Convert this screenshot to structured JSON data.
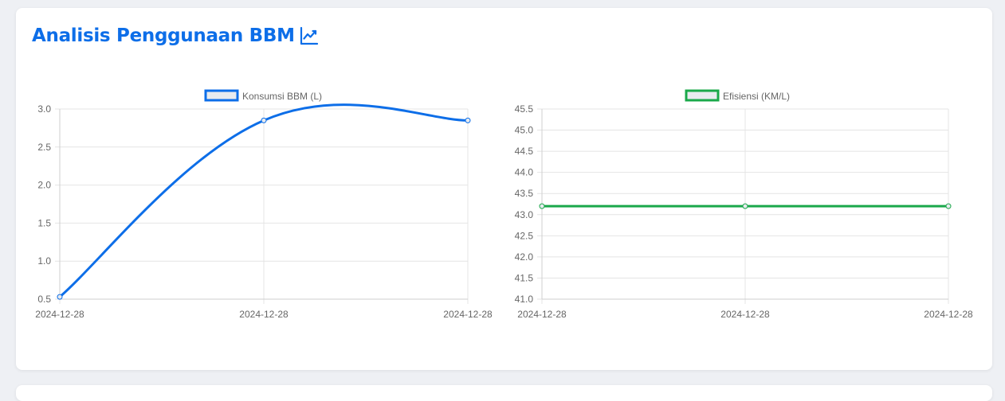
{
  "page": {
    "title": "Analisis Penggunaan BBM",
    "title_icon": "chart-line-icon",
    "accent_color": "#0d6ee8"
  },
  "chart_data": [
    {
      "type": "line",
      "series": [
        {
          "name": "Konsumsi BBM (L)",
          "color": "#0d6ee8",
          "fill": "#e8ebef",
          "x": [
            "2024-12-28",
            "2024-12-28",
            "2024-12-28"
          ],
          "values": [
            0.53,
            2.85,
            2.85
          ]
        }
      ],
      "x_tick_labels": [
        "2024-12-28",
        "2024-12-28",
        "2024-12-28"
      ],
      "y_ticks": [
        "3.0",
        "2.5",
        "2.0",
        "1.5",
        "1.0",
        "0.5"
      ],
      "ylim": [
        0.5,
        3.0
      ],
      "grid": true,
      "legend": "top"
    },
    {
      "type": "line",
      "series": [
        {
          "name": "Efisiensi (KM/L)",
          "color": "#1aa84a",
          "fill": "#e8ebef",
          "x": [
            "2024-12-28",
            "2024-12-28",
            "2024-12-28"
          ],
          "values": [
            43.2,
            43.2,
            43.2
          ]
        }
      ],
      "x_tick_labels": [
        "2024-12-28",
        "2024-12-28",
        "2024-12-28"
      ],
      "y_ticks": [
        "45.5",
        "45.0",
        "44.5",
        "44.0",
        "43.5",
        "43.0",
        "42.5",
        "42.0",
        "41.5",
        "41.0"
      ],
      "ylim": [
        41.0,
        45.5
      ],
      "grid": true,
      "legend": "top"
    }
  ]
}
